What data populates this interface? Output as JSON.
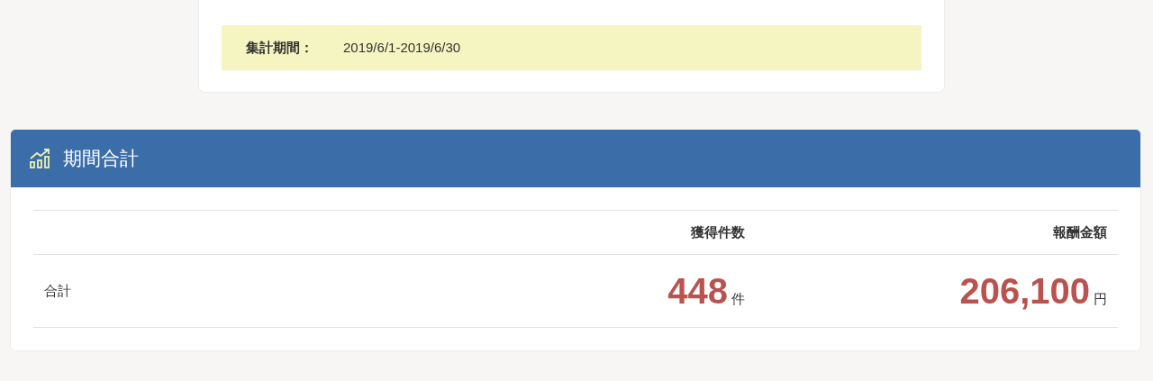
{
  "period": {
    "label": "集計期間：",
    "value": "2019/6/1-2019/6/30"
  },
  "panel": {
    "title": "期間合計",
    "table": {
      "columns": [
        "獲得件数",
        "報酬金額"
      ],
      "rows": [
        {
          "label": "合計",
          "count": "448",
          "count_unit": "件",
          "amount": "206,100",
          "amount_unit": "円"
        }
      ]
    }
  }
}
